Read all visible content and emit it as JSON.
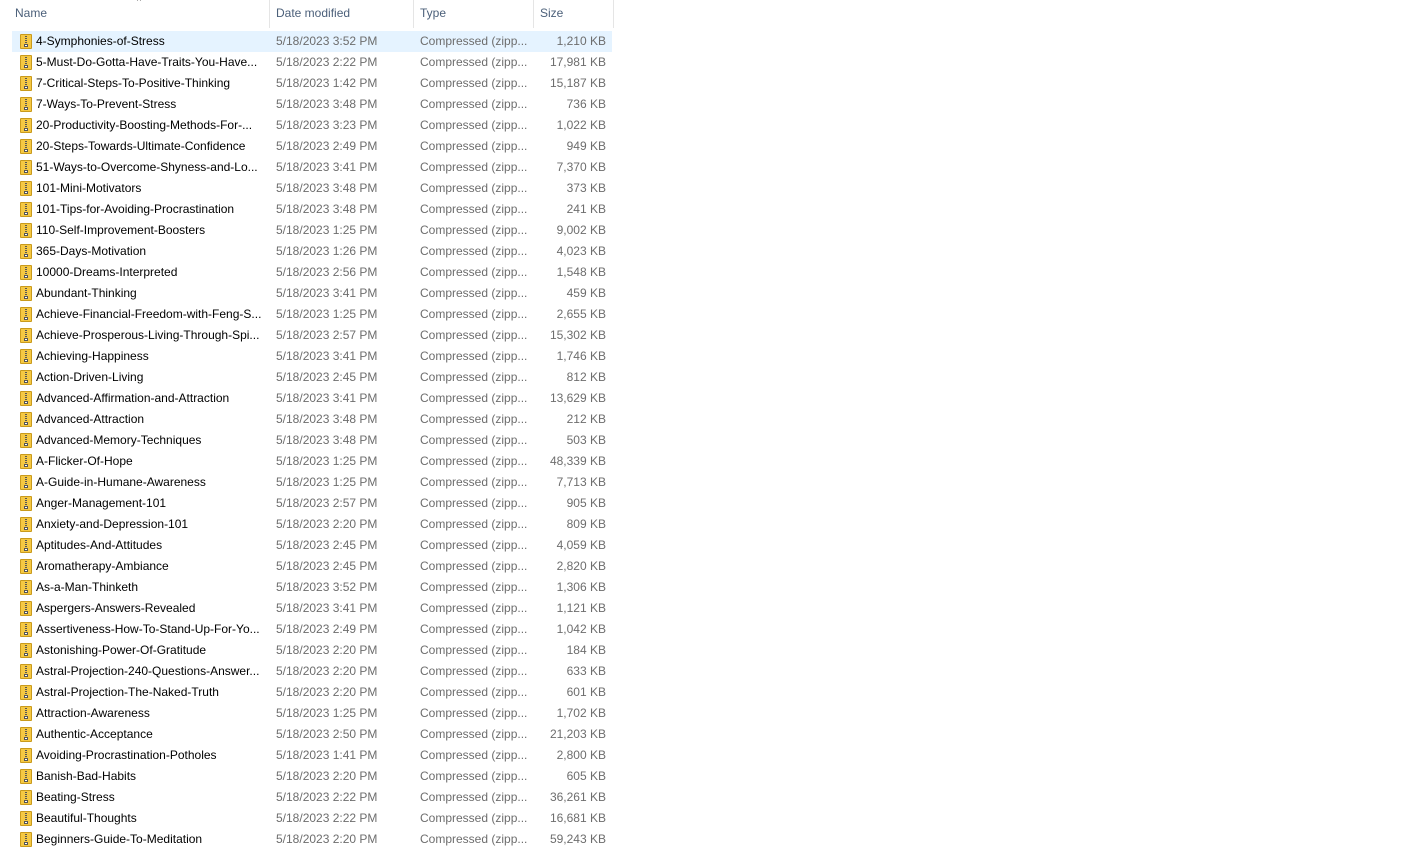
{
  "columns": {
    "name": "Name",
    "date": "Date modified",
    "type": "Type",
    "size": "Size"
  },
  "sort_indicator": "^",
  "files": [
    {
      "name": "4-Symphonies-of-Stress",
      "date": "5/18/2023 3:52 PM",
      "type": "Compressed (zipp...",
      "size": "1,210 KB",
      "selected": true
    },
    {
      "name": "5-Must-Do-Gotta-Have-Traits-You-Have...",
      "date": "5/18/2023 2:22 PM",
      "type": "Compressed (zipp...",
      "size": "17,981 KB"
    },
    {
      "name": "7-Critical-Steps-To-Positive-Thinking",
      "date": "5/18/2023 1:42 PM",
      "type": "Compressed (zipp...",
      "size": "15,187 KB"
    },
    {
      "name": "7-Ways-To-Prevent-Stress",
      "date": "5/18/2023 3:48 PM",
      "type": "Compressed (zipp...",
      "size": "736 KB"
    },
    {
      "name": "20-Productivity-Boosting-Methods-For-...",
      "date": "5/18/2023 3:23 PM",
      "type": "Compressed (zipp...",
      "size": "1,022 KB"
    },
    {
      "name": "20-Steps-Towards-Ultimate-Confidence",
      "date": "5/18/2023 2:49 PM",
      "type": "Compressed (zipp...",
      "size": "949 KB"
    },
    {
      "name": "51-Ways-to-Overcome-Shyness-and-Lo...",
      "date": "5/18/2023 3:41 PM",
      "type": "Compressed (zipp...",
      "size": "7,370 KB"
    },
    {
      "name": "101-Mini-Motivators",
      "date": "5/18/2023 3:48 PM",
      "type": "Compressed (zipp...",
      "size": "373 KB"
    },
    {
      "name": "101-Tips-for-Avoiding-Procrastination",
      "date": "5/18/2023 3:48 PM",
      "type": "Compressed (zipp...",
      "size": "241 KB"
    },
    {
      "name": "110-Self-Improvement-Boosters",
      "date": "5/18/2023 1:25 PM",
      "type": "Compressed (zipp...",
      "size": "9,002 KB"
    },
    {
      "name": "365-Days-Motivation",
      "date": "5/18/2023 1:26 PM",
      "type": "Compressed (zipp...",
      "size": "4,023 KB"
    },
    {
      "name": "10000-Dreams-Interpreted",
      "date": "5/18/2023 2:56 PM",
      "type": "Compressed (zipp...",
      "size": "1,548 KB"
    },
    {
      "name": "Abundant-Thinking",
      "date": "5/18/2023 3:41 PM",
      "type": "Compressed (zipp...",
      "size": "459 KB"
    },
    {
      "name": "Achieve-Financial-Freedom-with-Feng-S...",
      "date": "5/18/2023 1:25 PM",
      "type": "Compressed (zipp...",
      "size": "2,655 KB"
    },
    {
      "name": "Achieve-Prosperous-Living-Through-Spi...",
      "date": "5/18/2023 2:57 PM",
      "type": "Compressed (zipp...",
      "size": "15,302 KB"
    },
    {
      "name": "Achieving-Happiness",
      "date": "5/18/2023 3:41 PM",
      "type": "Compressed (zipp...",
      "size": "1,746 KB"
    },
    {
      "name": "Action-Driven-Living",
      "date": "5/18/2023 2:45 PM",
      "type": "Compressed (zipp...",
      "size": "812 KB"
    },
    {
      "name": "Advanced-Affirmation-and-Attraction",
      "date": "5/18/2023 3:41 PM",
      "type": "Compressed (zipp...",
      "size": "13,629 KB"
    },
    {
      "name": "Advanced-Attraction",
      "date": "5/18/2023 3:48 PM",
      "type": "Compressed (zipp...",
      "size": "212 KB"
    },
    {
      "name": "Advanced-Memory-Techniques",
      "date": "5/18/2023 3:48 PM",
      "type": "Compressed (zipp...",
      "size": "503 KB"
    },
    {
      "name": "A-Flicker-Of-Hope",
      "date": "5/18/2023 1:25 PM",
      "type": "Compressed (zipp...",
      "size": "48,339 KB"
    },
    {
      "name": "A-Guide-in-Humane-Awareness",
      "date": "5/18/2023 1:25 PM",
      "type": "Compressed (zipp...",
      "size": "7,713 KB"
    },
    {
      "name": "Anger-Management-101",
      "date": "5/18/2023 2:57 PM",
      "type": "Compressed (zipp...",
      "size": "905 KB"
    },
    {
      "name": "Anxiety-and-Depression-101",
      "date": "5/18/2023 2:20 PM",
      "type": "Compressed (zipp...",
      "size": "809 KB"
    },
    {
      "name": "Aptitudes-And-Attitudes",
      "date": "5/18/2023 2:45 PM",
      "type": "Compressed (zipp...",
      "size": "4,059 KB"
    },
    {
      "name": "Aromatherapy-Ambiance",
      "date": "5/18/2023 2:45 PM",
      "type": "Compressed (zipp...",
      "size": "2,820 KB"
    },
    {
      "name": "As-a-Man-Thinketh",
      "date": "5/18/2023 3:52 PM",
      "type": "Compressed (zipp...",
      "size": "1,306 KB"
    },
    {
      "name": "Aspergers-Answers-Revealed",
      "date": "5/18/2023 3:41 PM",
      "type": "Compressed (zipp...",
      "size": "1,121 KB"
    },
    {
      "name": "Assertiveness-How-To-Stand-Up-For-Yo...",
      "date": "5/18/2023 2:49 PM",
      "type": "Compressed (zipp...",
      "size": "1,042 KB"
    },
    {
      "name": "Astonishing-Power-Of-Gratitude",
      "date": "5/18/2023 2:20 PM",
      "type": "Compressed (zipp...",
      "size": "184 KB"
    },
    {
      "name": "Astral-Projection-240-Questions-Answer...",
      "date": "5/18/2023 2:20 PM",
      "type": "Compressed (zipp...",
      "size": "633 KB"
    },
    {
      "name": "Astral-Projection-The-Naked-Truth",
      "date": "5/18/2023 2:20 PM",
      "type": "Compressed (zipp...",
      "size": "601 KB"
    },
    {
      "name": "Attraction-Awareness",
      "date": "5/18/2023 1:25 PM",
      "type": "Compressed (zipp...",
      "size": "1,702 KB"
    },
    {
      "name": "Authentic-Acceptance",
      "date": "5/18/2023 2:50 PM",
      "type": "Compressed (zipp...",
      "size": "21,203 KB"
    },
    {
      "name": "Avoiding-Procrastination-Potholes",
      "date": "5/18/2023 1:41 PM",
      "type": "Compressed (zipp...",
      "size": "2,800 KB"
    },
    {
      "name": "Banish-Bad-Habits",
      "date": "5/18/2023 2:20 PM",
      "type": "Compressed (zipp...",
      "size": "605 KB"
    },
    {
      "name": "Beating-Stress",
      "date": "5/18/2023 2:22 PM",
      "type": "Compressed (zipp...",
      "size": "36,261 KB"
    },
    {
      "name": "Beautiful-Thoughts",
      "date": "5/18/2023 2:22 PM",
      "type": "Compressed (zipp...",
      "size": "16,681 KB"
    },
    {
      "name": "Beginners-Guide-To-Meditation",
      "date": "5/18/2023 2:20 PM",
      "type": "Compressed (zipp...",
      "size": "59,243 KB"
    }
  ]
}
